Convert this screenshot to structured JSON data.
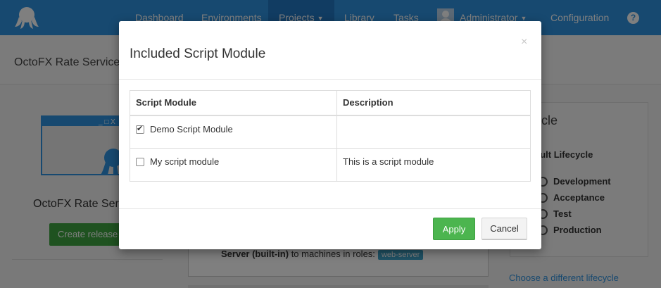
{
  "nav": {
    "items": [
      "Dashboard",
      "Environments",
      "Projects",
      "Library",
      "Tasks"
    ],
    "user": "Administrator",
    "configuration": "Configuration",
    "help": "?"
  },
  "page": {
    "project_title": "OctoFX Rate Service",
    "project_name": "OctoFX Rate Ser",
    "create_release": "Create release",
    "step_bold": "Server (built-in)",
    "step_text": " to machines in roles:",
    "role": "web-server",
    "lifecycle_title": "ycle",
    "lifecycle_name": "ault Lifecycle",
    "phases": [
      "Development",
      "Acceptance",
      "Test",
      "Production"
    ],
    "lifecycle_link": "Choose a different lifecycle"
  },
  "modal": {
    "title": "Included Script Module",
    "close": "×",
    "columns": [
      "Script Module",
      "Description"
    ],
    "rows": [
      {
        "name": "Demo Script Module",
        "description": "",
        "checked": true
      },
      {
        "name": "My script module",
        "description": "This is a script module",
        "checked": false
      }
    ],
    "apply": "Apply",
    "cancel": "Cancel"
  },
  "colors": {
    "nav_bg": "#2f93e0",
    "primary_green": "#4cb54f",
    "link": "#2f93e0"
  }
}
